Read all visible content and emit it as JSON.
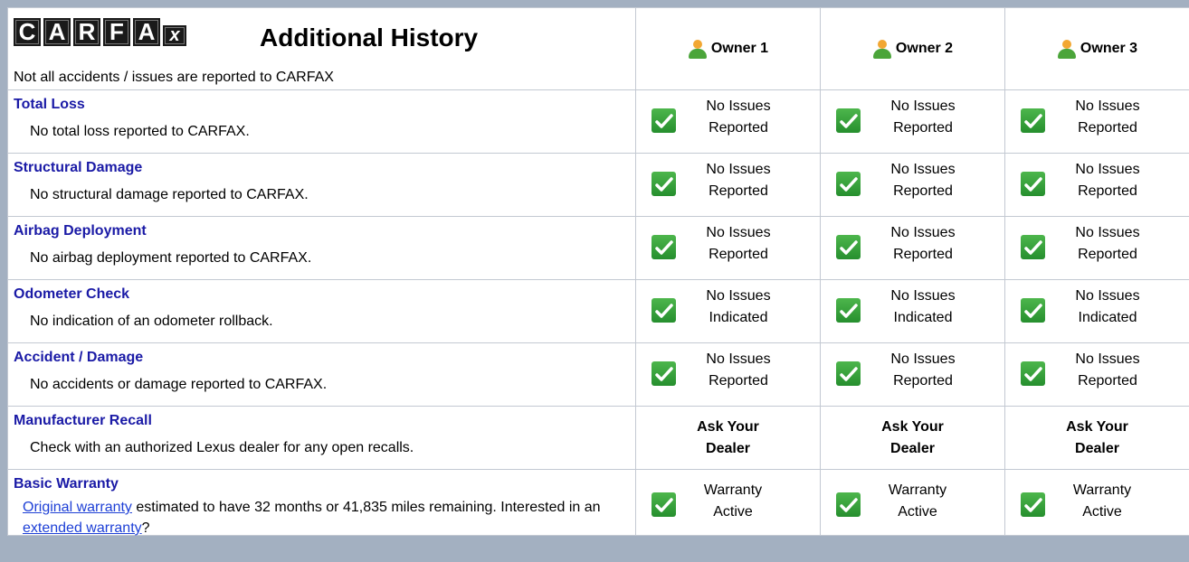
{
  "header": {
    "logo_letters": [
      "C",
      "A",
      "R",
      "F",
      "A",
      "x"
    ],
    "title": "Additional History",
    "subtitle": "Not all accidents / issues are reported to CARFAX"
  },
  "owners": [
    "Owner 1",
    "Owner 2",
    "Owner 3"
  ],
  "rows": [
    {
      "name": "Total Loss",
      "desc": "No total loss reported to CARFAX.",
      "status_line1": "No Issues",
      "status_line2": "Reported"
    },
    {
      "name": "Structural Damage",
      "desc": "No structural damage reported to CARFAX.",
      "status_line1": "No Issues",
      "status_line2": "Reported"
    },
    {
      "name": "Airbag Deployment",
      "desc": "No airbag deployment reported to CARFAX.",
      "status_line1": "No Issues",
      "status_line2": "Reported"
    },
    {
      "name": "Odometer Check",
      "desc": "No indication of an odometer rollback.",
      "status_line1": "No Issues",
      "status_line2": "Indicated"
    },
    {
      "name": "Accident / Damage",
      "desc": "No accidents or damage reported to CARFAX.",
      "status_line1": "No Issues",
      "status_line2": "Reported"
    },
    {
      "name": "Manufacturer Recall",
      "desc": "Check with an authorized Lexus dealer for any open recalls.",
      "status_line1": "Ask Your",
      "status_line2": "Dealer"
    }
  ],
  "warranty": {
    "name": "Basic Warranty",
    "link1": "Original warranty",
    "text1": " estimated to have 32 months or 41,835 miles remaining. Interested in an ",
    "link2": "extended warranty",
    "text2": "?",
    "status_line1": "Warranty",
    "status_line2": "Active"
  },
  "icons": {
    "owner": "person-icon",
    "status": "check-icon"
  },
  "colors": {
    "frame": "#a3b0c1",
    "row_title": "#1a1aa6",
    "link": "#1e40d6",
    "check": "#2e9e36",
    "owner_head": "#f2a733",
    "owner_body": "#4ba53a"
  }
}
